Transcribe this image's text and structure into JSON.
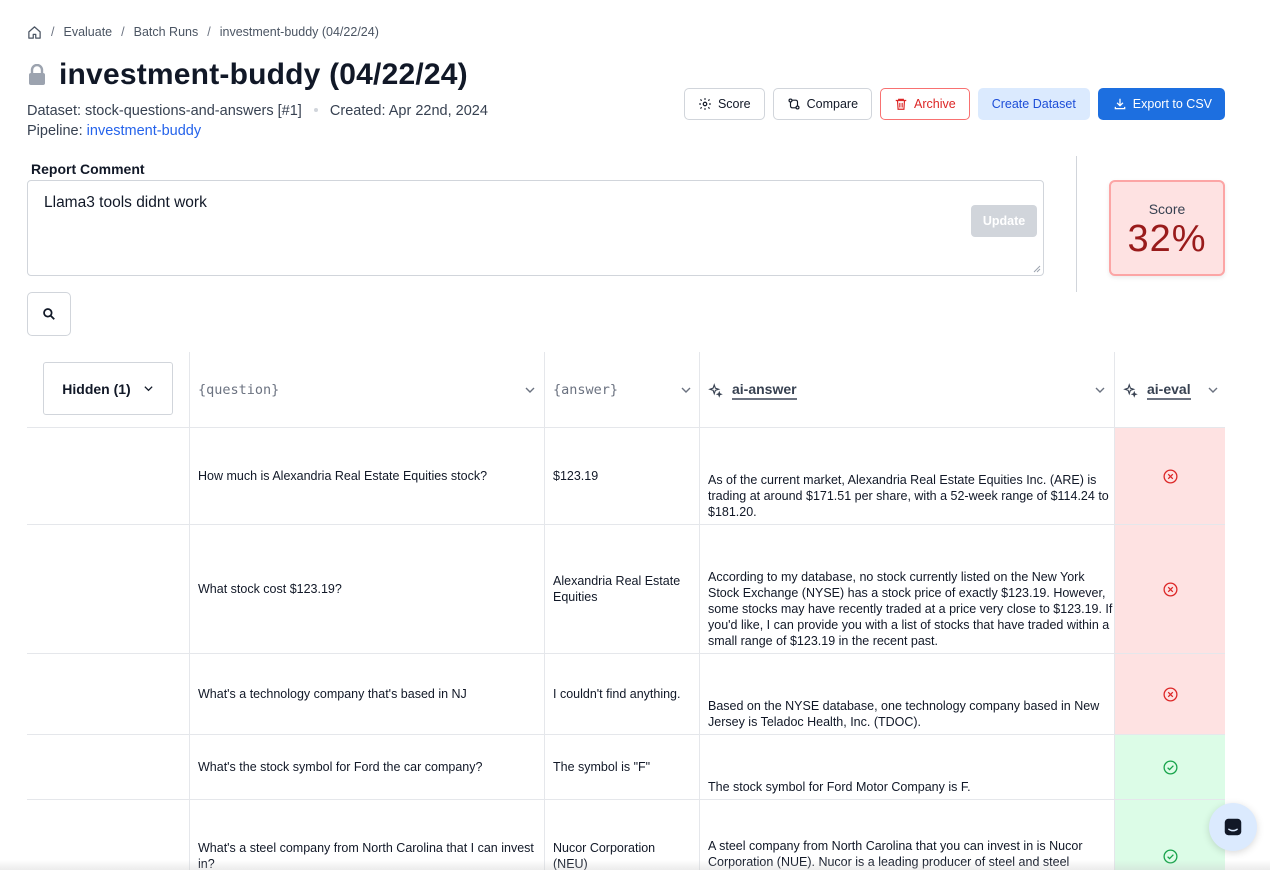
{
  "breadcrumb": {
    "items": [
      "Evaluate",
      "Batch Runs"
    ],
    "current": "investment-buddy (04/22/24)",
    "separator": "/"
  },
  "header": {
    "title": "investment-buddy (04/22/24)",
    "dataset_label": "Dataset:",
    "dataset_value": "stock-questions-and-answers [#1]",
    "created_label": "Created:",
    "created_value": "Apr 22nd, 2024",
    "pipeline_label": "Pipeline:",
    "pipeline_value": "investment-buddy"
  },
  "actions": {
    "score": "Score",
    "compare": "Compare",
    "archive": "Archive",
    "create_dataset": "Create Dataset",
    "export": "Export to CSV"
  },
  "comment": {
    "label": "Report Comment",
    "value": "Llama3 tools didnt work",
    "update": "Update"
  },
  "score": {
    "label": "Score",
    "value": "32%"
  },
  "table": {
    "hidden_button": "Hidden (1)",
    "columns": [
      "{question}",
      "{answer}",
      "ai-answer",
      "ai-eval"
    ],
    "rows": [
      {
        "question": "How much is Alexandria Real Estate Equities stock?",
        "answer": "$123.19",
        "ai_answer": "As of the current market, Alexandria Real Estate Equities Inc. (ARE) is trading at around $171.51 per share, with a 52-week range of $114.24 to $181.20.",
        "eval": "fail"
      },
      {
        "question": "What stock cost $123.19?",
        "answer": "Alexandria Real Estate Equities",
        "ai_answer": "According to my database, no stock currently listed on the New York Stock Exchange (NYSE) has a stock price of exactly $123.19. However, some stocks may have recently traded at a price very close to $123.19. If you'd like, I can provide you with a list of stocks that have traded within a small range of $123.19 in the recent past.",
        "eval": "fail"
      },
      {
        "question": "What's a technology company that's based in NJ",
        "answer": "I couldn't find anything.",
        "ai_answer": "Based on the NYSE database, one technology company based in New Jersey is Teladoc Health, Inc. (TDOC).",
        "eval": "fail"
      },
      {
        "question": "What's the stock symbol for Ford the car company?",
        "answer": "The symbol is \"F\"",
        "ai_answer": "The stock symbol for Ford Motor Company is F.",
        "eval": "pass"
      },
      {
        "question": "What's a steel company from North Carolina that I can invest in?",
        "answer": "Nucor Corporation (NEU)",
        "ai_answer": "A steel company from North Carolina that you can invest in is Nucor Corporation (NUE). Nucor is a leading producer of steel and steel",
        "eval": "pass"
      }
    ]
  },
  "colors": {
    "primary": "#1d6fe0",
    "fail_bg": "#fee2e2",
    "pass_bg": "#dcfce7",
    "fail_icon": "#dc2626",
    "pass_icon": "#16a34a",
    "score_text": "#991b1b"
  }
}
